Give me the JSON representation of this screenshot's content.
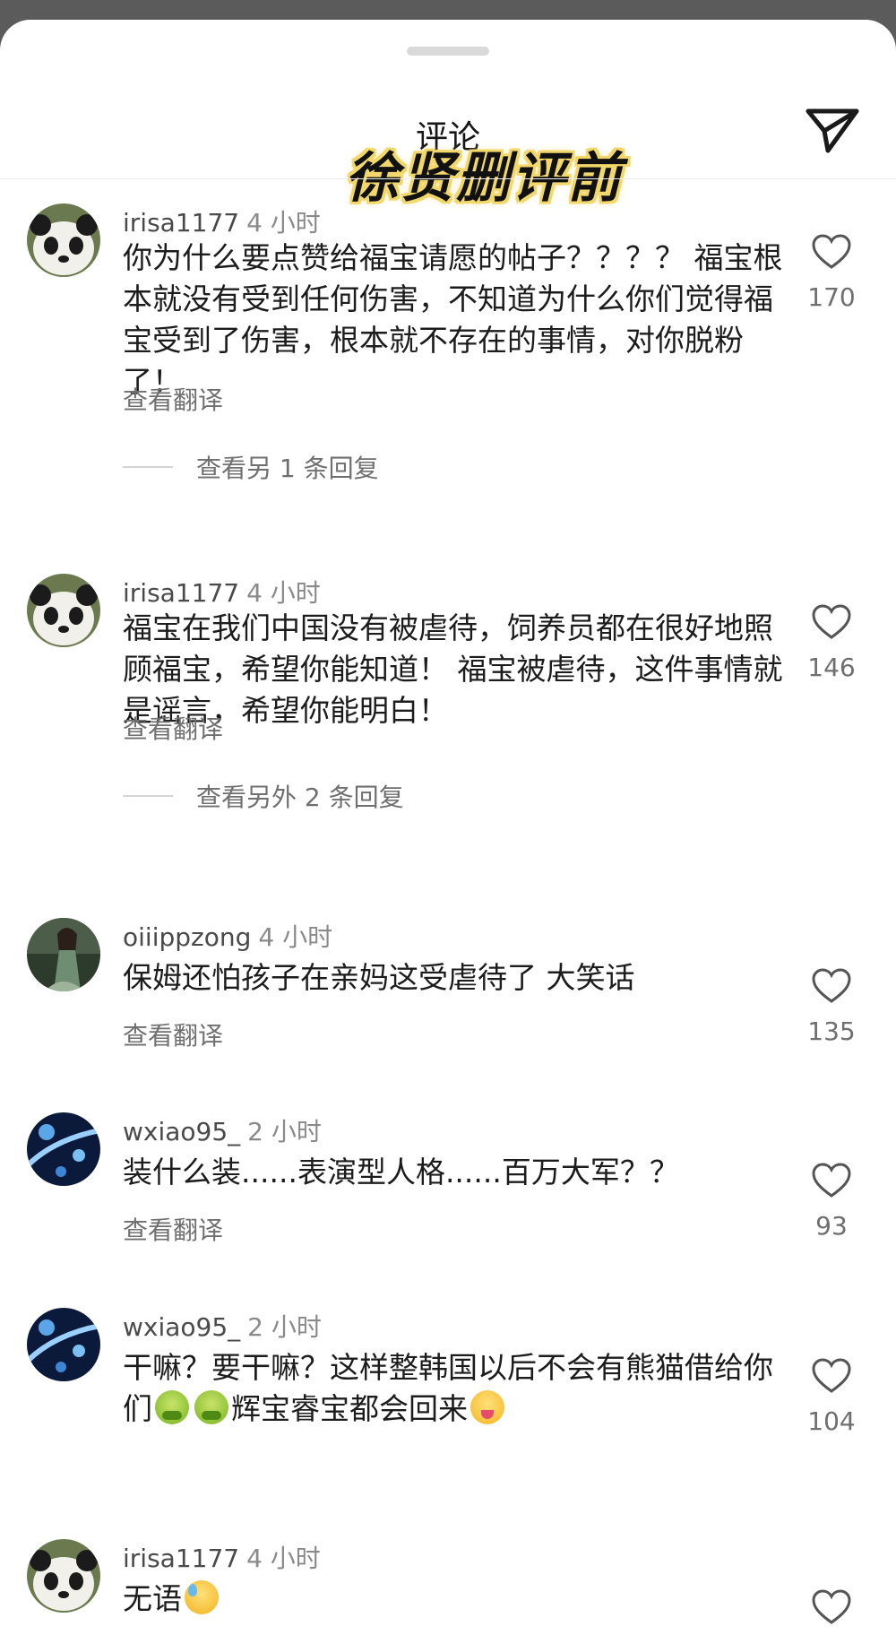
{
  "header": {
    "title": "评论",
    "overlay_caption": "徐贤删评前",
    "share_icon": "send-icon"
  },
  "comments": [
    {
      "username": "irisa1177",
      "time": "4 小时",
      "text": "你为什么要点赞给福宝请愿的帖子？？？？ 福宝根本就没有受到任何伤害，不知道为什么你们觉得福宝受到了伤害，根本就不存在的事情，对你脱粉了！",
      "translate": "查看翻译",
      "likes": "170",
      "replies": "查看另 1 条回复",
      "avatar": "panda-avatar"
    },
    {
      "username": "irisa1177",
      "time": "4 小时",
      "text": "福宝在我们中国没有被虐待，饲养员都在很好地照顾福宝，希望你能知道！ 福宝被虐待，这件事情就是谣言，希望你能明白！",
      "translate": "查看翻译",
      "likes": "146",
      "replies": "查看另外 2 条回复",
      "avatar": "panda-avatar"
    },
    {
      "username": "oiiippzong",
      "time": "4 小时",
      "text": "保姆还怕孩子在亲妈这受虐待了 大笑话",
      "translate": "查看翻译",
      "likes": "135",
      "avatar": "person-avatar"
    },
    {
      "username": "wxiao95_",
      "time": "2 小时",
      "text": "装什么装......表演型人格......百万大军？？",
      "translate": "查看翻译",
      "likes": "93",
      "avatar": "blue-abstract-avatar"
    },
    {
      "username": "wxiao95_",
      "time": "2 小时",
      "text_part1": "干嘛？要干嘛？这样整韩国以后不会有熊猫借给你们",
      "text_part2": "辉宝睿宝都会回来",
      "likes": "104",
      "avatar": "blue-abstract-avatar"
    },
    {
      "username": "irisa1177",
      "time": "4 小时",
      "text": "无语",
      "avatar": "panda-avatar"
    }
  ],
  "colors": {
    "background_dim": "#5b5b5b",
    "sheet": "#ffffff",
    "caption_glow": "#f2d76a"
  }
}
